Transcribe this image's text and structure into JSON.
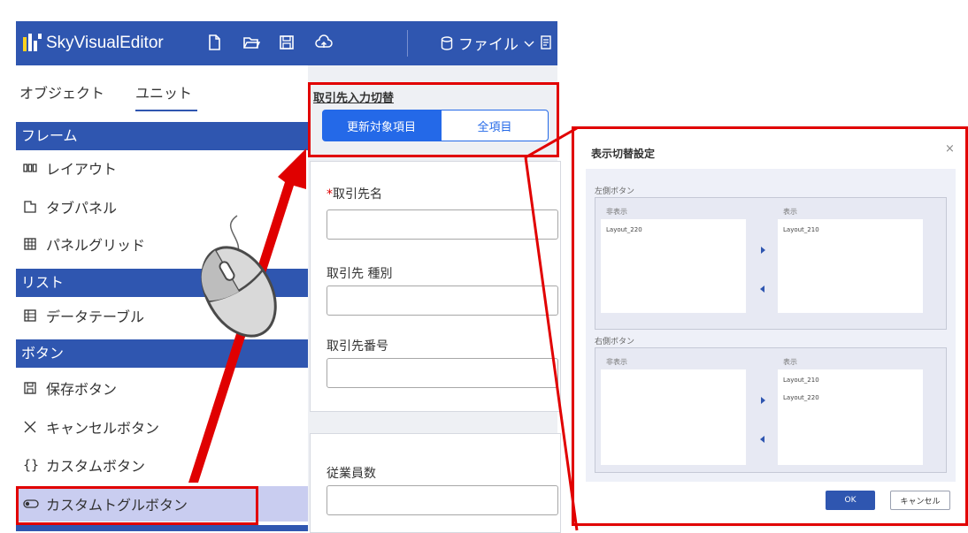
{
  "app": {
    "brand": "SkyVisualEditor",
    "file_menu": "ファイル",
    "icons": [
      "new-file-icon",
      "open-folder-icon",
      "save-icon",
      "cloud-upload-icon",
      "database-icon"
    ]
  },
  "sidebar": {
    "tabs": [
      {
        "label": "オブジェクト"
      },
      {
        "label": "ユニット"
      }
    ],
    "sections": [
      {
        "title": "フレーム",
        "items": [
          {
            "label": "レイアウト",
            "icon": "layout-columns-icon"
          },
          {
            "label": "タブパネル",
            "icon": "tab-panel-icon"
          },
          {
            "label": "パネルグリッド",
            "icon": "grid-icon"
          }
        ]
      },
      {
        "title": "リスト",
        "items": [
          {
            "label": "データテーブル",
            "icon": "table-icon"
          }
        ]
      },
      {
        "title": "ボタン",
        "items": [
          {
            "label": "保存ボタン",
            "icon": "save-icon"
          },
          {
            "label": "キャンセルボタン",
            "icon": "close-icon"
          },
          {
            "label": "カスタムボタン",
            "icon": "braces-icon"
          },
          {
            "label": "カスタムトグルボタン",
            "icon": "toggle-icon"
          }
        ]
      }
    ]
  },
  "form": {
    "toggle_title": "取引先入力切替",
    "toggle_options": [
      "更新対象項目",
      "全項目"
    ],
    "fields": [
      {
        "label": "取引先名",
        "required": true
      },
      {
        "label": "取引先 種別",
        "required": false
      },
      {
        "label": "取引先番号",
        "required": false
      }
    ],
    "field2": {
      "label": "従業員数"
    },
    "required_mark": "*"
  },
  "dialog": {
    "title": "表示切替設定",
    "close": "×",
    "left_group": {
      "label": "左側ボタン",
      "hidden_label": "非表示",
      "shown_label": "表示",
      "hidden_items": [
        "Layout_220"
      ],
      "shown_items": [
        "Layout_210"
      ]
    },
    "right_group": {
      "label": "右側ボタン",
      "hidden_label": "非表示",
      "shown_label": "表示",
      "hidden_items": [],
      "shown_items": [
        "Layout_210",
        "Layout_220"
      ]
    },
    "ok": "OK",
    "cancel": "キャンセル"
  },
  "colors": {
    "primary": "#2f56b0",
    "selected": "#c9cdf0",
    "annotation": "#e10000"
  }
}
